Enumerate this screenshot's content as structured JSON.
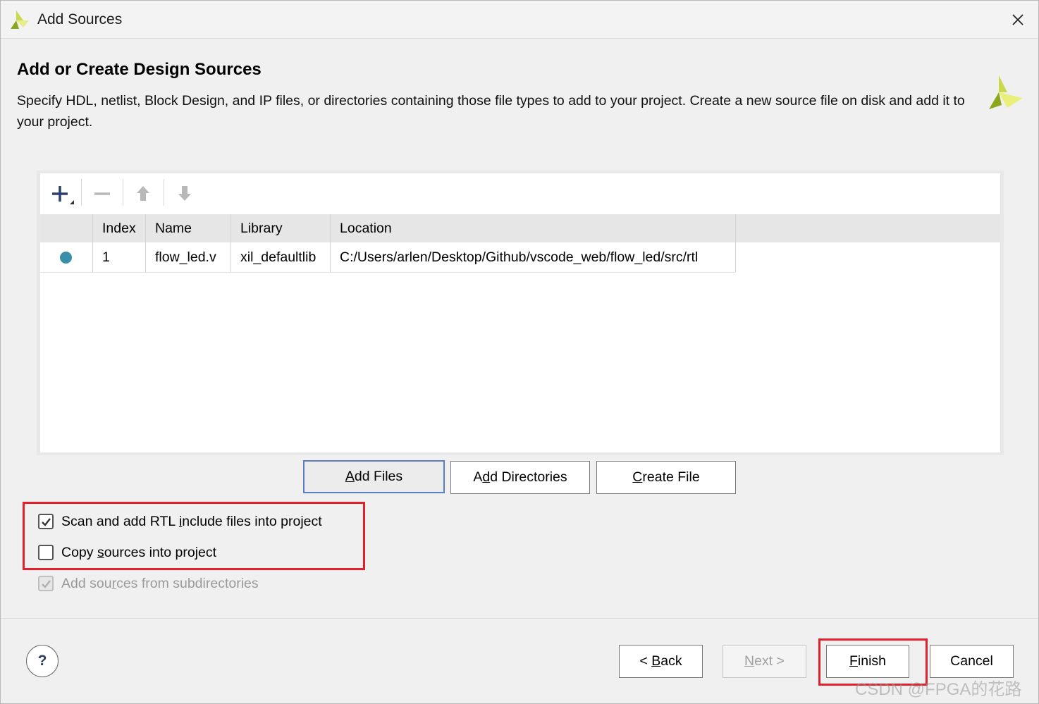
{
  "window": {
    "title": "Add Sources",
    "close_icon": "close-icon"
  },
  "header": {
    "heading": "Add or Create Design Sources",
    "description": "Specify HDL, netlist, Block Design, and IP files, or directories containing those file types to add to your project. Create a new source file on disk and add it to your project."
  },
  "toolbar": {
    "add_icon": "plus-icon",
    "remove_icon": "minus-icon",
    "up_icon": "arrow-up-icon",
    "down_icon": "arrow-down-icon"
  },
  "table": {
    "columns": [
      "",
      "Index",
      "Name",
      "Library",
      "Location"
    ],
    "rows": [
      {
        "status": "status-dot",
        "index": "1",
        "name": "flow_led.v",
        "library": "xil_defaultlib",
        "location": "C:/Users/arlen/Desktop/Github/vscode_web/flow_led/src/rtl"
      }
    ]
  },
  "actions": {
    "add_files": {
      "pre": "",
      "accel": "A",
      "post": "dd Files"
    },
    "add_directories": {
      "pre": "A",
      "accel": "d",
      "post": "d Directories"
    },
    "create_file": {
      "pre": "",
      "accel": "C",
      "post": "reate File"
    }
  },
  "options": {
    "scan_rtl": {
      "pre": "Scan and add RTL ",
      "accel": "i",
      "post": "nclude files into project",
      "checked": true
    },
    "copy_sources": {
      "pre": "Copy ",
      "accel": "s",
      "post": "ources into project",
      "checked": false
    },
    "add_subdirs": {
      "pre": "Add sou",
      "accel": "r",
      "post": "ces from subdirectories",
      "checked": true,
      "disabled": true
    }
  },
  "footer": {
    "help_label": "?",
    "back": {
      "pre": "< ",
      "accel": "B",
      "post": "ack"
    },
    "next": {
      "pre": "",
      "accel": "N",
      "post": "ext >"
    },
    "finish": {
      "pre": "",
      "accel": "F",
      "post": "inish"
    },
    "cancel": "Cancel"
  },
  "watermark": "CSDN @FPGA的花路",
  "colors": {
    "accent_red": "#e0202b",
    "status_dot": "#3a8eaa",
    "logo_green": "#9aba1e",
    "logo_yellow": "#e9f07a"
  }
}
